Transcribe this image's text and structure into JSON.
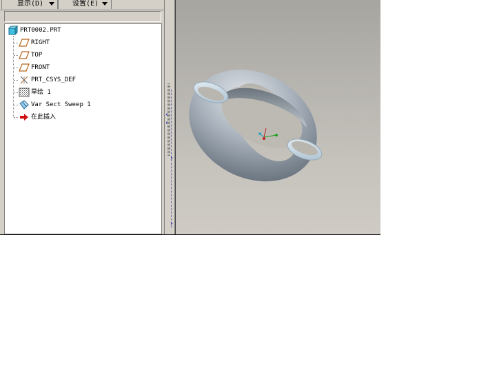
{
  "menu": {
    "display_label": "显示(D)",
    "settings_label": "设置(E)"
  },
  "tree": {
    "items": [
      {
        "label": "PRT0002.PRT",
        "icon": "part-icon"
      },
      {
        "label": "RIGHT",
        "icon": "datum-plane-icon"
      },
      {
        "label": "TOP",
        "icon": "datum-plane-icon"
      },
      {
        "label": "FRONT",
        "icon": "datum-plane-icon"
      },
      {
        "label": "PRT_CSYS_DEF",
        "icon": "csys-icon"
      },
      {
        "label": "草绘 1",
        "icon": "sketch-icon"
      },
      {
        "label": "Var Sect Sweep 1",
        "icon": "sweep-icon"
      },
      {
        "label": "在此插入",
        "icon": "insert-arrow-icon"
      }
    ]
  },
  "colors": {
    "window_bg": "#d4d0c8",
    "datum_plane": "#b5651d",
    "part_icon": "#40c0e0",
    "insert_arrow": "#d01010"
  }
}
